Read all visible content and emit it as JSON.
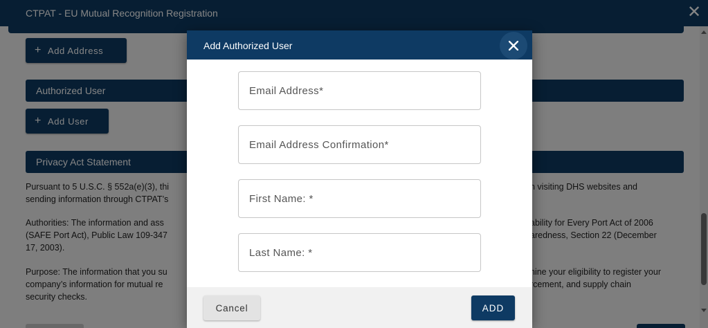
{
  "window": {
    "title": "CTPAT - EU Mutual Recognition Registration",
    "close_symbol": "✕"
  },
  "background": {
    "add_address_label": "Add Address",
    "authorized_user_heading": "Authorized User",
    "add_user_label": "Add User",
    "privacy_heading": "Privacy Act Statement",
    "paragraph1_left": "Pursuant to 5 U.S.C. § 552a(e)(3), thi\nsending information through CTPAT’s",
    "paragraph1_right": "n visiting DHS websites and",
    "paragraph2_left": "Authorities: The information and ass\n(SAFE Port Act), Public Law 109-347\n17, 2003).",
    "paragraph2_right": "ability for Every Port Act of 2006\naredness, Section 22 (December",
    "paragraph3_left": "Purpose: The information that you su\ncompany’s information for mutual re\nsecurity checks.",
    "paragraph3_right": "nine your eligibility to register your\nrcement, and supply chain"
  },
  "modal": {
    "title": "Add Authorized User",
    "fields": {
      "email": {
        "placeholder": "Email Address*",
        "value": ""
      },
      "email_confirm": {
        "placeholder": "Email Address Confirmation*",
        "value": ""
      },
      "first_name": {
        "placeholder": "First Name: *",
        "value": ""
      },
      "last_name": {
        "placeholder": "Last Name: *",
        "value": ""
      }
    },
    "cancel_label": "Cancel",
    "add_label": "ADD"
  },
  "colors": {
    "primary_navy": "#0e3a63",
    "overlay": "rgba(0,0,0,0.48)"
  },
  "icons": {
    "window_close": "close-icon",
    "modal_close": "close-icon",
    "add": "plus-icon"
  }
}
